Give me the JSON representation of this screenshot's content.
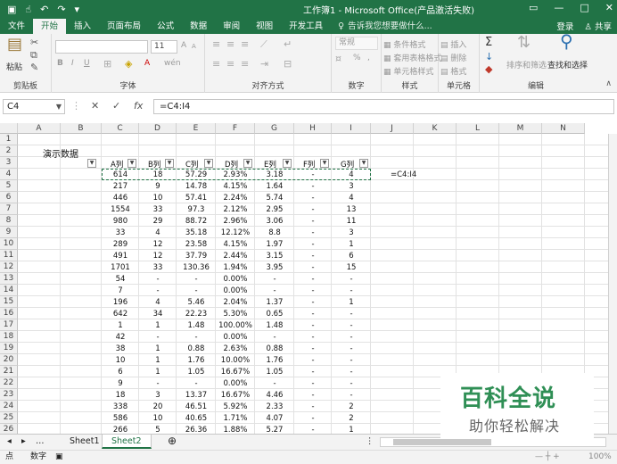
{
  "title_bar": {
    "title": "工作簿1 - Microsoft Office(产品激活失败)",
    "save_icon": "save-icon",
    "undo_icon": "undo-icon",
    "redo_icon": "redo-icon"
  },
  "tabs": [
    "文件",
    "开始",
    "插入",
    "页面布局",
    "公式",
    "数据",
    "审阅",
    "视图",
    "开发工具"
  ],
  "active_tab": "开始",
  "tell_me": "告诉我您想要做什么...",
  "login": "登录",
  "share": "共享",
  "ribbon": {
    "paste": "粘贴",
    "clipboard": "剪贴板",
    "font_size": "11",
    "font_group": "字体",
    "align_group": "对齐方式",
    "number_format": "常规",
    "number_group": "数字",
    "cond_format": "条件格式",
    "table_format": "套用表格格式",
    "cell_style": "单元格样式",
    "style_group": "样式",
    "insert": "插入",
    "delete": "删除",
    "format": "格式",
    "cells_group": "单元格",
    "sort_filter": "排序和筛选",
    "find_select": "查找和选择",
    "edit_group": "编辑",
    "bold": "B",
    "italic": "I",
    "underline": "U",
    "font_grow": "A",
    "font_shrink": "A",
    "font_color": "A",
    "wen": "wén",
    "percent": "%",
    "comma": ",",
    "sum": "Σ"
  },
  "formula_bar": {
    "name_box": "C4",
    "formula": "=C4:I4",
    "cancel": "✕",
    "enter": "✓",
    "fx": "fx"
  },
  "columns": [
    "A",
    "B",
    "C",
    "D",
    "E",
    "F",
    "G",
    "H",
    "I",
    "J",
    "K",
    "L",
    "M",
    "N"
  ],
  "rows": [
    "1",
    "2",
    "3",
    "4",
    "5",
    "6",
    "7",
    "8",
    "9",
    "10",
    "11",
    "12",
    "13",
    "14",
    "15",
    "16",
    "17",
    "18",
    "19",
    "20",
    "21",
    "22",
    "23",
    "24",
    "25",
    "26"
  ],
  "sheet_title": "演示数据",
  "headers": [
    "A列",
    "B列",
    "C列",
    "D列",
    "E列",
    "F列",
    "G列"
  ],
  "data": [
    [
      "614",
      "18",
      "57.29",
      "2.93%",
      "3.18",
      "-",
      "4"
    ],
    [
      "217",
      "9",
      "14.78",
      "4.15%",
      "1.64",
      "-",
      "3"
    ],
    [
      "446",
      "10",
      "57.41",
      "2.24%",
      "5.74",
      "-",
      "4"
    ],
    [
      "1554",
      "33",
      "97.3",
      "2.12%",
      "2.95",
      "-",
      "13"
    ],
    [
      "980",
      "29",
      "88.72",
      "2.96%",
      "3.06",
      "-",
      "11"
    ],
    [
      "33",
      "4",
      "35.18",
      "12.12%",
      "8.8",
      "-",
      "3"
    ],
    [
      "289",
      "12",
      "23.58",
      "4.15%",
      "1.97",
      "-",
      "1"
    ],
    [
      "491",
      "12",
      "37.79",
      "2.44%",
      "3.15",
      "-",
      "6"
    ],
    [
      "1701",
      "33",
      "130.36",
      "1.94%",
      "3.95",
      "-",
      "15"
    ],
    [
      "54",
      "-",
      "-",
      "0.00%",
      "-",
      "-",
      "-"
    ],
    [
      "7",
      "-",
      "-",
      "0.00%",
      "-",
      "-",
      "-"
    ],
    [
      "196",
      "4",
      "5.46",
      "2.04%",
      "1.37",
      "-",
      "1"
    ],
    [
      "642",
      "34",
      "22.23",
      "5.30%",
      "0.65",
      "-",
      "-"
    ],
    [
      "1",
      "1",
      "1.48",
      "100.00%",
      "1.48",
      "-",
      "-"
    ],
    [
      "42",
      "-",
      "-",
      "0.00%",
      "-",
      "-",
      "-"
    ],
    [
      "38",
      "1",
      "0.88",
      "2.63%",
      "0.88",
      "-",
      "-"
    ],
    [
      "10",
      "1",
      "1.76",
      "10.00%",
      "1.76",
      "-",
      "-"
    ],
    [
      "6",
      "1",
      "1.05",
      "16.67%",
      "1.05",
      "-",
      "-"
    ],
    [
      "9",
      "-",
      "-",
      "0.00%",
      "-",
      "-",
      "-"
    ],
    [
      "18",
      "3",
      "13.37",
      "16.67%",
      "4.46",
      "-",
      "-"
    ],
    [
      "338",
      "20",
      "46.51",
      "5.92%",
      "2.33",
      "-",
      "2"
    ],
    [
      "586",
      "10",
      "40.65",
      "1.71%",
      "4.07",
      "-",
      "2"
    ],
    [
      "266",
      "5",
      "26.36",
      "1.88%",
      "5.27",
      "-",
      "1"
    ]
  ],
  "side_formula": "=C4:I4",
  "sheets": [
    "Sheet1",
    "Sheet2"
  ],
  "active_sheet": "Sheet2",
  "add_sheet": "⊕",
  "status": {
    "mode": "点",
    "num": "数字",
    "zoom": "100%"
  },
  "watermark": {
    "line1": "百科全说",
    "line2": "助你轻松解决"
  },
  "colors": {
    "accent": "#217346",
    "watermark": "#2f8f55"
  }
}
